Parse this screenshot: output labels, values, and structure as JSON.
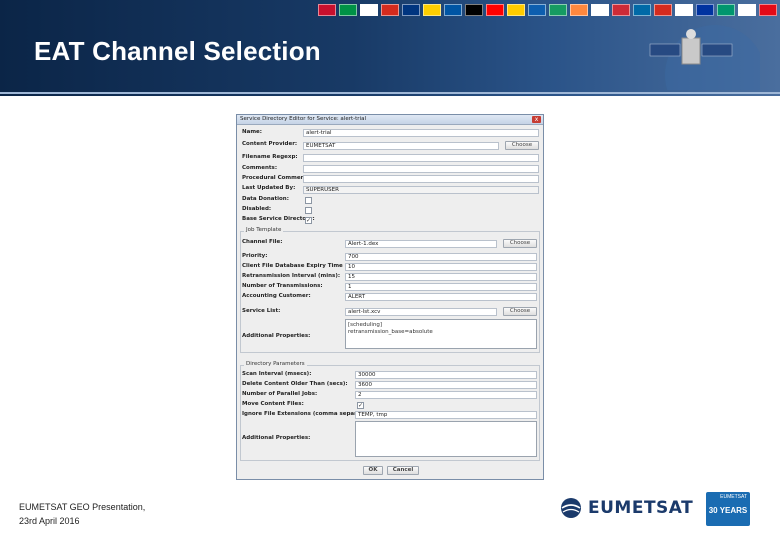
{
  "slide": {
    "title": "EAT Channel Selection",
    "footer_line1": "EUMETSAT GEO Presentation,",
    "footer_line2": "23rd April 2016",
    "logo_text": "EUMETSAT",
    "badge_text": "30 YEARS",
    "badge_brand": "EUMETSAT"
  },
  "flags": [
    "#c8102e",
    "#009246",
    "#ffffff",
    "#d52b1e",
    "#003580",
    "#ffce00",
    "#0055a4",
    "#000000",
    "#ff0000",
    "#ffcc00",
    "#0d5eaf",
    "#169b62",
    "#ff883e",
    "#ffffff",
    "#ce2b37",
    "#006aa7",
    "#d52b1e",
    "#ffffff",
    "#0033a0",
    "#00966e",
    "#ffffff",
    "#e30a17",
    "#012169",
    "#0057b7",
    "#ffd500"
  ],
  "dialog": {
    "title": "Service Directory Editor for Service: alert-trial",
    "close": "x",
    "name_label": "Name:",
    "name_value": "alert-trial",
    "provider_label": "Content Provider:",
    "provider_value": "EUMETSAT",
    "choose1": "Choose",
    "regexp_label": "Filename Regexp:",
    "regexp_value": "",
    "comments_label": "Comments:",
    "comments_value": "",
    "proc_comments_label": "Procedural Comments:",
    "proc_comments_value": "",
    "updated_label": "Last Updated By:",
    "updated_value": "SUPERUSER",
    "data_donation_label": "Data Donation:",
    "disabled_label": "Disabled:",
    "base_dir_label": "Base Service Directory:",
    "check_mark": "✓",
    "job_template_title": "Job Template",
    "channel_file_label": "Channel File:",
    "channel_file_value": "Alert-1.dex",
    "choose2": "Choose",
    "priority_label": "Priority:",
    "priority_value": "700",
    "expiry_label": "Client File Database Expiry Time (mins):",
    "expiry_value": "10",
    "retrans_label": "Retransmission Interval (mins):",
    "retrans_value": "15",
    "num_trans_label": "Number of Transmissions:",
    "num_trans_value": "1",
    "customer_label": "Accounting Customer:",
    "customer_value": "ALERT",
    "service_list_label": "Service List:",
    "service_list_value": "alert-lst.xcv",
    "choose3": "Choose",
    "add_props_label": "Additional Properties:",
    "add_props_value": "[scheduling]\nretransmission_base=absolute",
    "dir_params_title": "Directory Parameters",
    "scan_label": "Scan Interval (msecs):",
    "scan_value": "30000",
    "delete_label": "Delete Content Older Than (secs):",
    "delete_value": "3600",
    "parallel_label": "Number of Parallel Jobs:",
    "parallel_value": "2",
    "move_label": "Move Content Files:",
    "ignore_label": "Ignore File Extensions (comma separated):",
    "ignore_value": "TEMP, tmp",
    "add_props2_label": "Additional Properties:",
    "add_props2_value": "",
    "ok": "OK",
    "cancel": "Cancel"
  }
}
